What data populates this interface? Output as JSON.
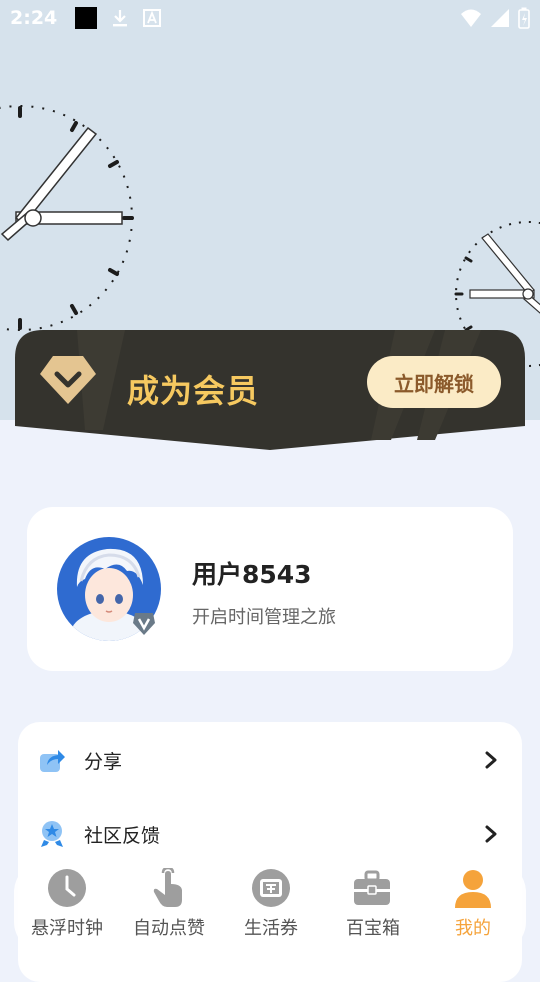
{
  "status_bar": {
    "time": "2:24"
  },
  "vip_banner": {
    "title": "成为会员",
    "unlock_button": "立即解锁",
    "colors": {
      "banner_bg": "#34332d",
      "title": "#f6c960",
      "button_bg": "#fbebc6",
      "button_text": "#8b5a2b"
    }
  },
  "profile": {
    "name": "用户8543",
    "subtitle": "开启时间管理之旅"
  },
  "menu": {
    "items": [
      {
        "label": "分享",
        "icon": "share-icon"
      },
      {
        "label": "社区反馈",
        "icon": "feedback-icon"
      }
    ]
  },
  "tabbar": {
    "items": [
      {
        "label": "悬浮时钟",
        "icon": "clock-icon",
        "active": false
      },
      {
        "label": "自动点赞",
        "icon": "tap-hand-icon",
        "active": false
      },
      {
        "label": "生活券",
        "icon": "coupon-icon",
        "active": false
      },
      {
        "label": "百宝箱",
        "icon": "toolbox-icon",
        "active": false
      },
      {
        "label": "我的",
        "icon": "person-icon",
        "active": true
      }
    ],
    "active_color": "#f5a33b"
  }
}
